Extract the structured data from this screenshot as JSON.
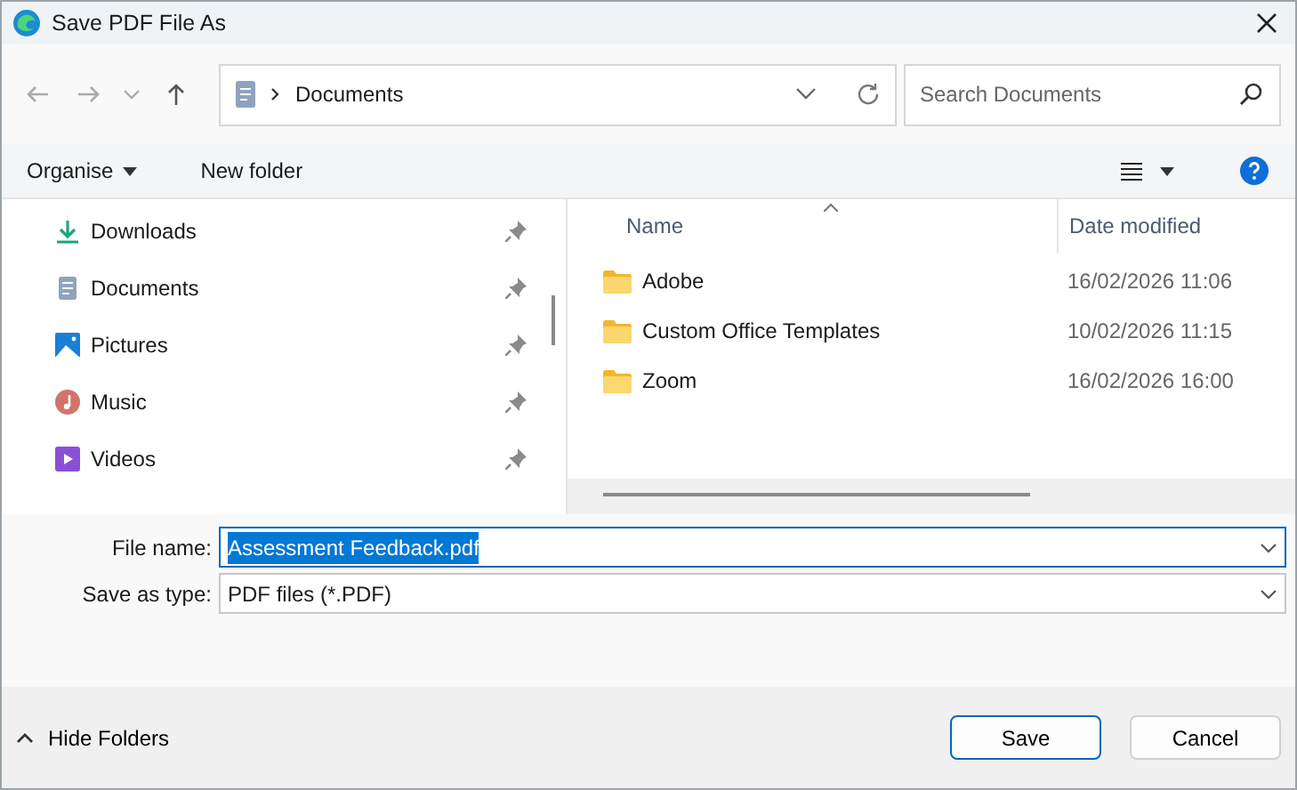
{
  "window": {
    "title": "Save PDF File As"
  },
  "address_bar": {
    "location": "Documents"
  },
  "search": {
    "placeholder": "Search Documents"
  },
  "toolbar": {
    "organise": "Organise",
    "new_folder": "New folder"
  },
  "sidebar": {
    "items": [
      {
        "label": "Downloads",
        "kind": "downloads",
        "pinned": true
      },
      {
        "label": "Documents",
        "kind": "documents",
        "pinned": true
      },
      {
        "label": "Pictures",
        "kind": "pictures",
        "pinned": true
      },
      {
        "label": "Music",
        "kind": "music",
        "pinned": true
      },
      {
        "label": "Videos",
        "kind": "videos",
        "pinned": true
      }
    ]
  },
  "file_list": {
    "columns": [
      "Name",
      "Date modified"
    ],
    "rows": [
      {
        "name": "Adobe",
        "date_modified": "16/02/2026 11:06"
      },
      {
        "name": "Custom Office Templates",
        "date_modified": "10/02/2026 11:15"
      },
      {
        "name": "Zoom",
        "date_modified": "16/02/2026 16:00"
      }
    ]
  },
  "form": {
    "file_name_label": "File name:",
    "file_name": "Assessment Feedback.pdf",
    "file_name_selected": true,
    "type_label": "Save as type:",
    "type": "PDF files (*.PDF)"
  },
  "footer": {
    "hide_folders": "Hide Folders",
    "buttons": [
      "Save",
      "Cancel"
    ]
  }
}
